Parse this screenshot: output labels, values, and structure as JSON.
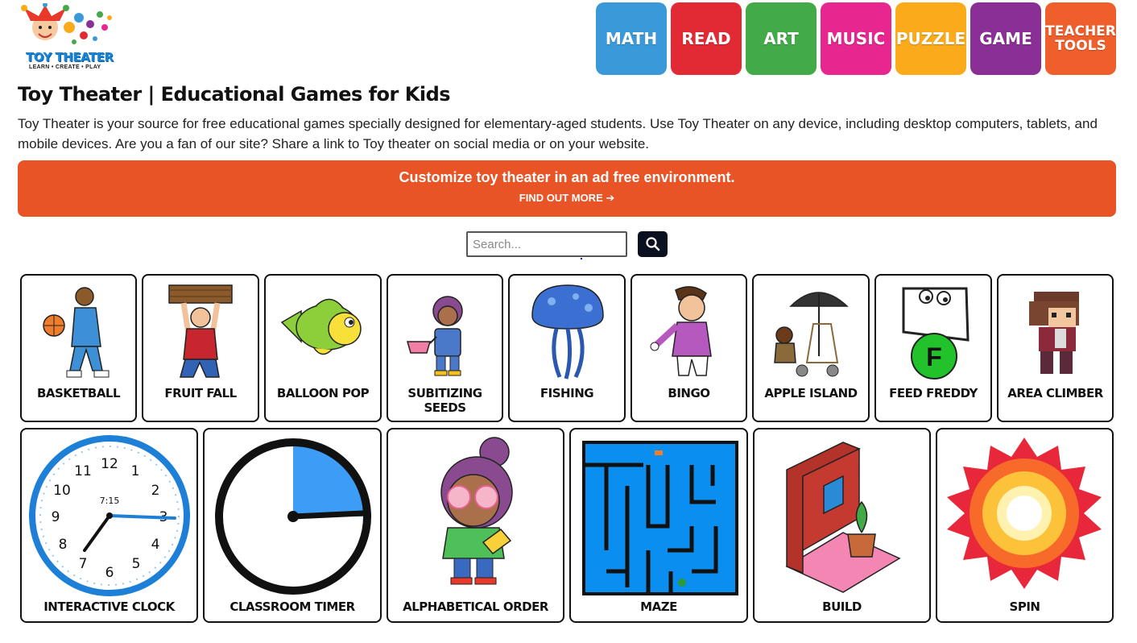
{
  "logo": {
    "name": "TOY THEATER",
    "tagline": "LEARN • CREATE • PLAY"
  },
  "nav": [
    {
      "label": "MATH",
      "color": "#3a9ad9"
    },
    {
      "label": "READ",
      "color": "#e22a34"
    },
    {
      "label": "ART",
      "color": "#43aa48"
    },
    {
      "label": "MUSIC",
      "color": "#e8268f"
    },
    {
      "label": "PUZZLE",
      "color": "#fbab1a"
    },
    {
      "label": "GAME",
      "color": "#8a2f96"
    },
    {
      "label": "TEACHER TOOLS",
      "color": "#ef5f2b"
    }
  ],
  "page_title": "Toy Theater | Educational Games for Kids",
  "intro": "Toy Theater is your source for free educational games specially designed for elementary-aged students. Use Toy Theater on any device, including desktop computers, tablets, and mobile devices. Are you a fan of our site? Share a link to Toy theater on social media or on your website.",
  "banner": {
    "title": "Customize toy theater in an ad free environment.",
    "link": "FIND OUT MORE ➔",
    "color": "#e85425"
  },
  "search": {
    "placeholder": "Search..."
  },
  "games_row1": [
    "BASKETBALL",
    "FRUIT FALL",
    "BALLOON POP",
    "SUBITIZING SEEDS",
    "FISHING",
    "BINGO",
    "APPLE ISLAND",
    "FEED FREDDY",
    "AREA CLIMBER"
  ],
  "games_row2": [
    "INTERACTIVE CLOCK",
    "CLASSROOM TIMER",
    "ALPHABETICAL ORDER",
    "MAZE",
    "BUILD",
    "SPIN"
  ],
  "clock": {
    "digital": "7:15",
    "numbers": [
      "12",
      "1",
      "2",
      "3",
      "4",
      "5",
      "6",
      "7",
      "8",
      "9",
      "10",
      "11"
    ]
  },
  "freddy_letter": "F"
}
